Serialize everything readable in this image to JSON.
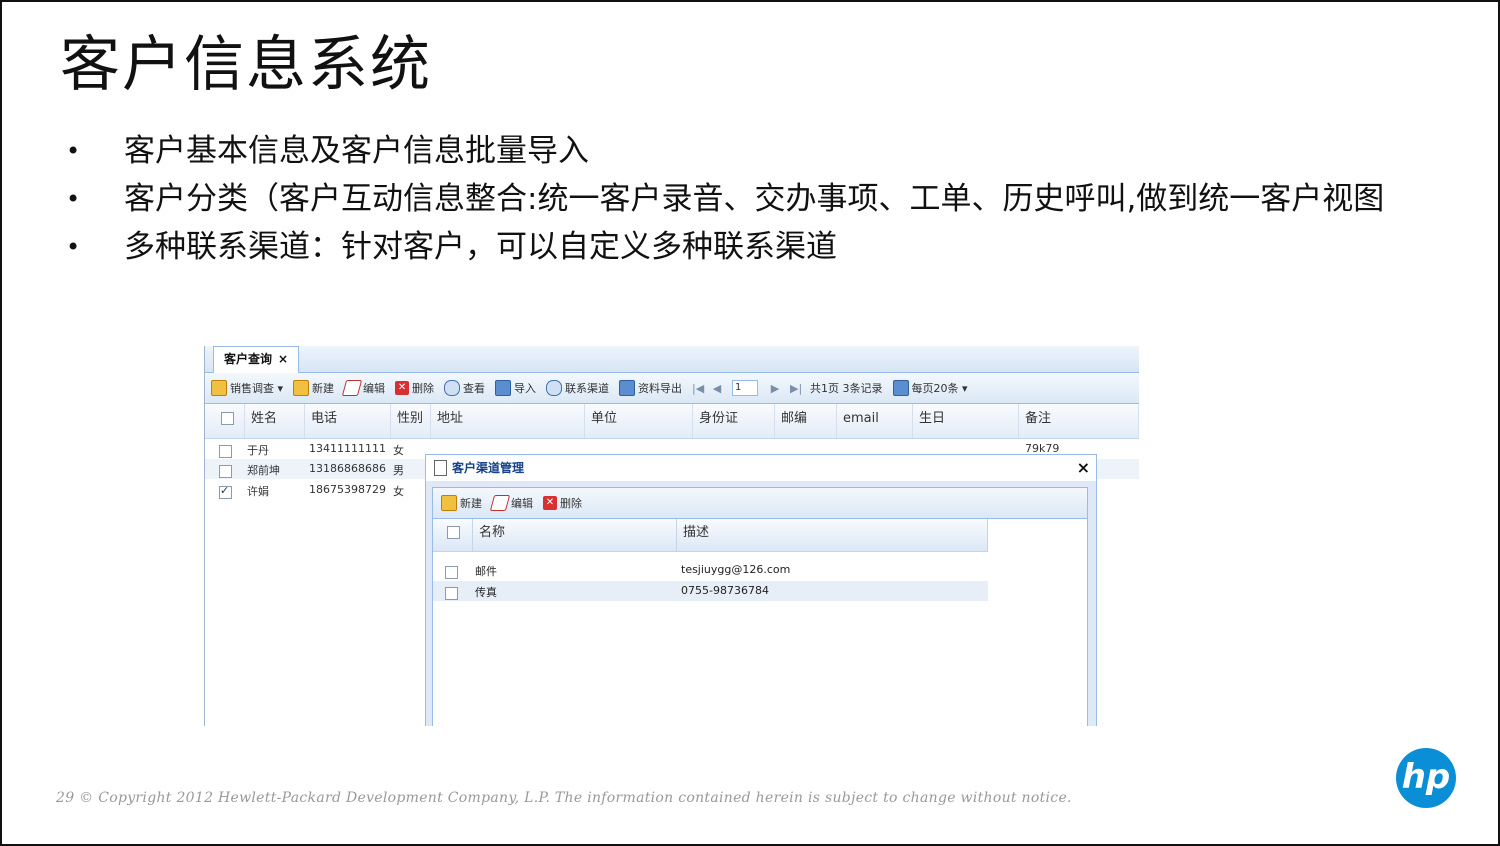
{
  "slide": {
    "title": "客户信息系统",
    "bullets": [
      "客户基本信息及客户信息批量导入",
      "客户分类（客户互动信息整合:统一客户录音、交办事项、工单、历史呼叫,做到统一客户视图",
      "多种联系渠道：针对客户，可以自定义多种联系渠道"
    ],
    "bullet_glyph": "•",
    "footer": "29   © Copyright 2012 Hewlett-Packard Development Company, L.P.  The information contained herein is subject to change without notice.",
    "logo_text": "hp"
  },
  "app": {
    "tab_label": "客户查询",
    "tab_close": "×",
    "toolbar": {
      "survey": "销售调查",
      "new": "新建",
      "edit": "编辑",
      "delete": "删除",
      "view": "查看",
      "import": "导入",
      "channels": "联系渠道",
      "export": "资料导出",
      "page_value": "1",
      "page_info": "共1页  3条记录",
      "per_page": "每页20条"
    },
    "columns": [
      "姓名",
      "电话",
      "性别",
      "地址",
      "单位",
      "身份证",
      "邮编",
      "email",
      "生日",
      "备注"
    ],
    "rows": [
      {
        "name": "于丹",
        "phone": "13411111111",
        "gender": "女",
        "note": "79k79",
        "checked": false
      },
      {
        "name": "郑前坤",
        "phone": "13186868686",
        "gender": "男",
        "note": "",
        "checked": false
      },
      {
        "name": "许娟",
        "phone": "18675398729",
        "gender": "女",
        "note": "",
        "checked": true
      }
    ]
  },
  "dialog": {
    "title": "客户渠道管理",
    "close": "×",
    "toolbar": {
      "new": "新建",
      "edit": "编辑",
      "delete": "删除"
    },
    "columns": [
      "名称",
      "描述"
    ],
    "rows": [
      {
        "name": "邮件",
        "desc": "tesjiuygg@126.com"
      },
      {
        "name": "传真",
        "desc": "0755-98736784"
      }
    ]
  },
  "colors": {
    "accent": "#99bbe8",
    "logo": "#0a8fd6",
    "dialog_title": "#15428b"
  }
}
